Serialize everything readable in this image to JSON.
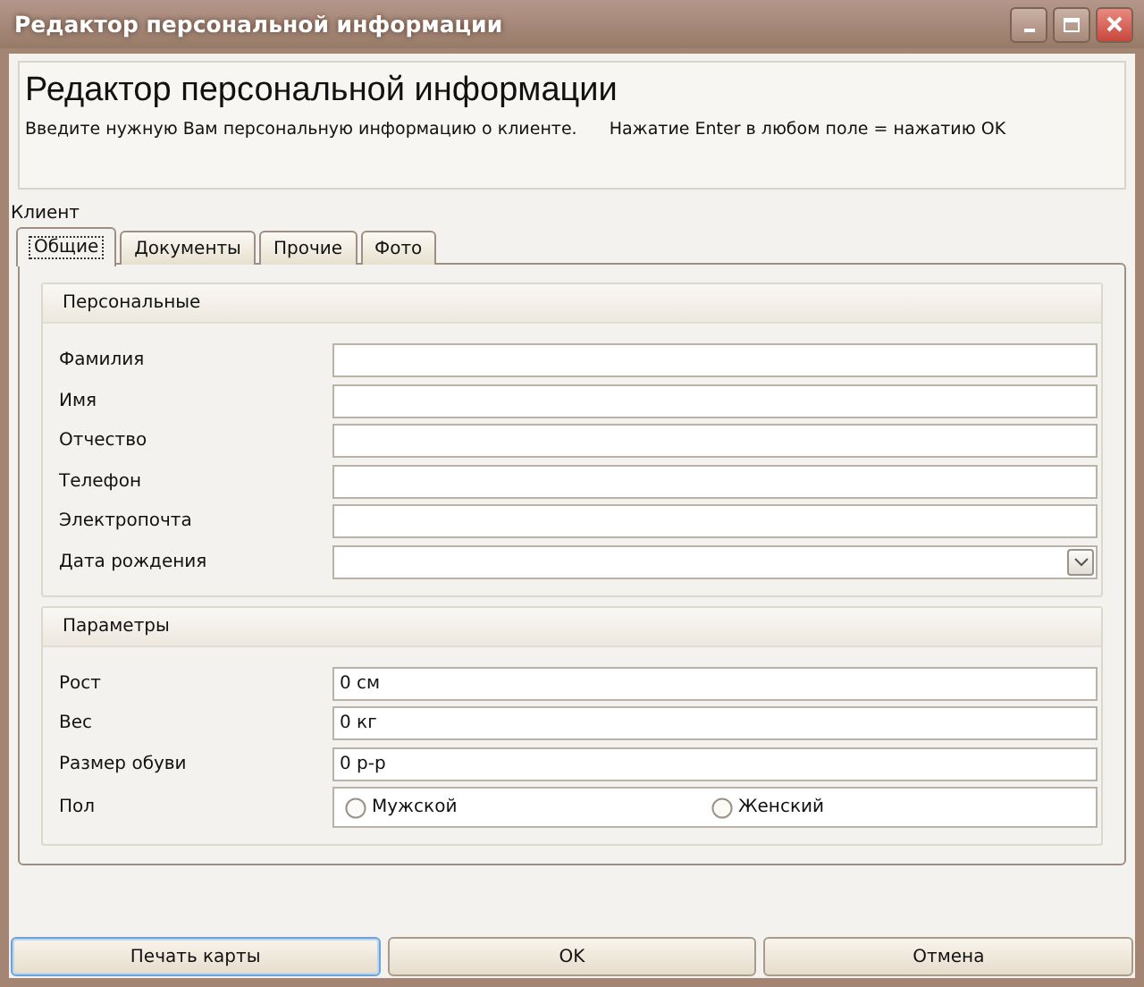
{
  "window": {
    "title": "Редактор персональной информации"
  },
  "header": {
    "title": "Редактор персональной информации",
    "hint": "Введите нужную Вам персональную информацию о клиенте.",
    "enter_hint": "Нажатие Enter в любом поле = нажатию OK"
  },
  "section_label": "Клиент",
  "tabs": [
    {
      "label": "Общие",
      "selected": true
    },
    {
      "label": "Документы",
      "selected": false
    },
    {
      "label": "Прочие",
      "selected": false
    },
    {
      "label": "Фото",
      "selected": false
    }
  ],
  "groups": [
    {
      "title": "Персональные",
      "fields": [
        {
          "kind": "text",
          "label": "Фамилия"
        },
        {
          "kind": "text",
          "label": "Имя"
        },
        {
          "kind": "text",
          "label": "Отчество"
        },
        {
          "kind": "text",
          "label": "Телефон"
        },
        {
          "kind": "text",
          "label": "Электропочта"
        },
        {
          "kind": "date",
          "label": "Дата рождения"
        }
      ]
    },
    {
      "title": "Параметры",
      "fields": [
        {
          "kind": "text",
          "label": "Рост",
          "value": "0 см"
        },
        {
          "kind": "text",
          "label": "Вес",
          "value": "0 кг"
        },
        {
          "kind": "text",
          "label": "Размер обуви",
          "value": "0 р-р"
        },
        {
          "kind": "radio",
          "label": "Пол",
          "options": [
            {
              "label": "Мужской",
              "selected": false
            },
            {
              "label": "Женский",
              "selected": false
            }
          ]
        }
      ]
    }
  ],
  "buttons": [
    {
      "label": "Печать карты",
      "focused": true
    },
    {
      "label": "OK",
      "focused": false
    },
    {
      "label": "Отмена",
      "focused": false
    }
  ]
}
